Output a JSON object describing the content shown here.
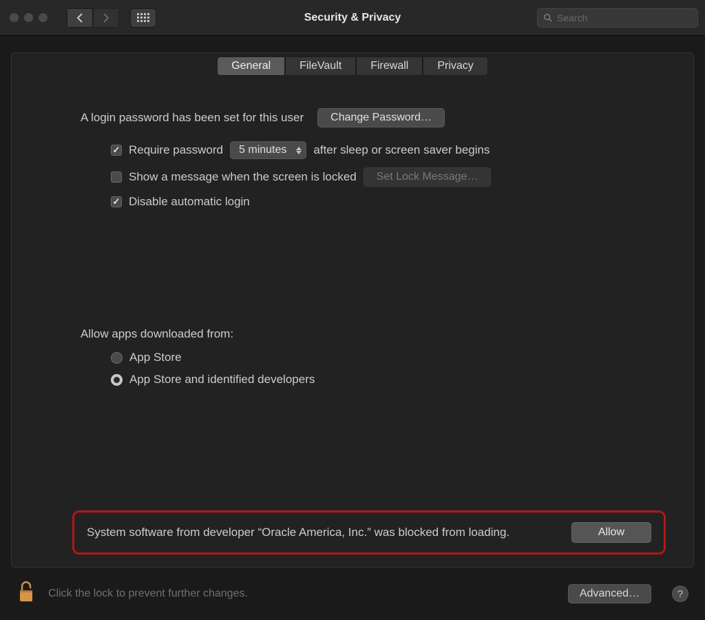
{
  "toolbar": {
    "title": "Security & Privacy",
    "search_placeholder": "Search"
  },
  "tabs": [
    {
      "label": "General",
      "active": true
    },
    {
      "label": "FileVault",
      "active": false
    },
    {
      "label": "Firewall",
      "active": false
    },
    {
      "label": "Privacy",
      "active": false
    }
  ],
  "general": {
    "login_password_text": "A login password has been set for this user",
    "change_password_label": "Change Password…",
    "require_password_label": "Require password",
    "require_password_select": "5 minutes",
    "after_sleep_text": "after sleep or screen saver begins",
    "show_message_label": "Show a message when the screen is locked",
    "set_lock_message_label": "Set Lock Message…",
    "disable_auto_login_label": "Disable automatic login",
    "allow_apps_label": "Allow apps downloaded from:",
    "radio_app_store": "App Store",
    "radio_identified": "App Store and identified developers",
    "blocked_message": "System software from developer “Oracle America, Inc.” was blocked from loading.",
    "allow_label": "Allow"
  },
  "footer": {
    "lock_text": "Click the lock to prevent further changes.",
    "advanced_label": "Advanced…",
    "help_label": "?"
  }
}
